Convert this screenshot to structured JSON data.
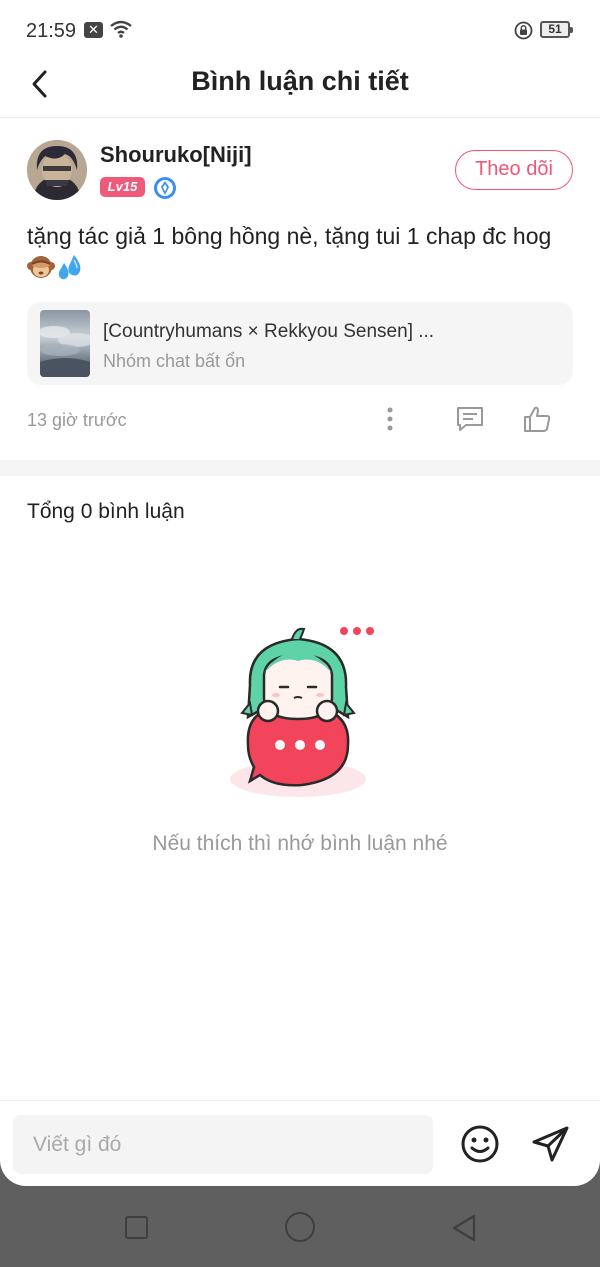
{
  "status_bar": {
    "time": "21:59",
    "battery": "51",
    "notification_icon": "x-icon",
    "wifi_icon": "wifi-icon",
    "rotation_lock_icon": "rotation-lock-icon"
  },
  "header": {
    "title": "Bình luận chi tiết",
    "back_icon": "chevron-left-icon"
  },
  "post": {
    "username": "Shouruko[Niji]",
    "level": "Lv15",
    "follow_label": "Theo dõi",
    "text": "tặng tác giả 1 bông hồng nè, tặng tui 1 chap đc hog",
    "emojis": [
      "monkey-emoji",
      "sweat-droplets-emoji"
    ],
    "linked_story": {
      "title": "[Countryhumans × Rekkyou Sensen] ...",
      "subtitle": "Nhóm chat bất ổn"
    },
    "time_ago": "13 giờ trước"
  },
  "comments": {
    "total_label": "Tổng 0 bình luận",
    "empty_text": "Nếu thích thì nhớ bình luận nhé"
  },
  "input": {
    "placeholder": "Viết gì đó"
  },
  "colors": {
    "accent": "#ef5777",
    "badge": "#f05a7a",
    "mascot_hair": "#5fd3a8",
    "mascot_bubble": "#f2455c"
  }
}
